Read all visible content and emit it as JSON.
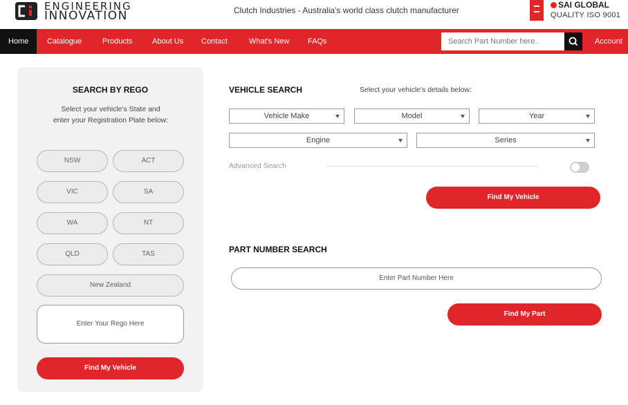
{
  "header": {
    "logo_line1": "ENGINEERING",
    "logo_line2": "INNOVATION",
    "tagline": "Clutch Industries - Australia's world class clutch manufacturer",
    "cert_logo": "SAI GLOBAL",
    "cert_sub": "QUALITY ISO 9001"
  },
  "nav": {
    "items": [
      "Home",
      "Catalogue",
      "Products",
      "About Us",
      "Contact",
      "What's New",
      "FAQs"
    ],
    "active": "Home",
    "search_placeholder": "Search Part Number here..",
    "account": "Account"
  },
  "rego": {
    "title": "SEARCH BY REGO",
    "description": "Select your vehicle's State and enter your Registration Plate below:",
    "states": [
      "NSW",
      "ACT",
      "VIC",
      "SA",
      "WA",
      "NT",
      "QLD",
      "TAS",
      "New Zealand"
    ],
    "input_placeholder": "Enter Your Rego Here",
    "button": "Find My Vehicle"
  },
  "vehicle_search": {
    "title": "VEHICLE SEARCH",
    "hint": "Select your vehicle's details below:",
    "selects": [
      "Vehicle Make",
      "Model",
      "Year",
      "Engine",
      "Series"
    ],
    "advanced": "Advanced Search",
    "button": "Find My Vehicle"
  },
  "part_search": {
    "title": "PART NUMBER SEARCH",
    "input_placeholder": "Enter Part Number Here",
    "button": "Find My Part"
  },
  "colors": {
    "brand_red": "#e1262a",
    "nav_active": "#111111"
  }
}
